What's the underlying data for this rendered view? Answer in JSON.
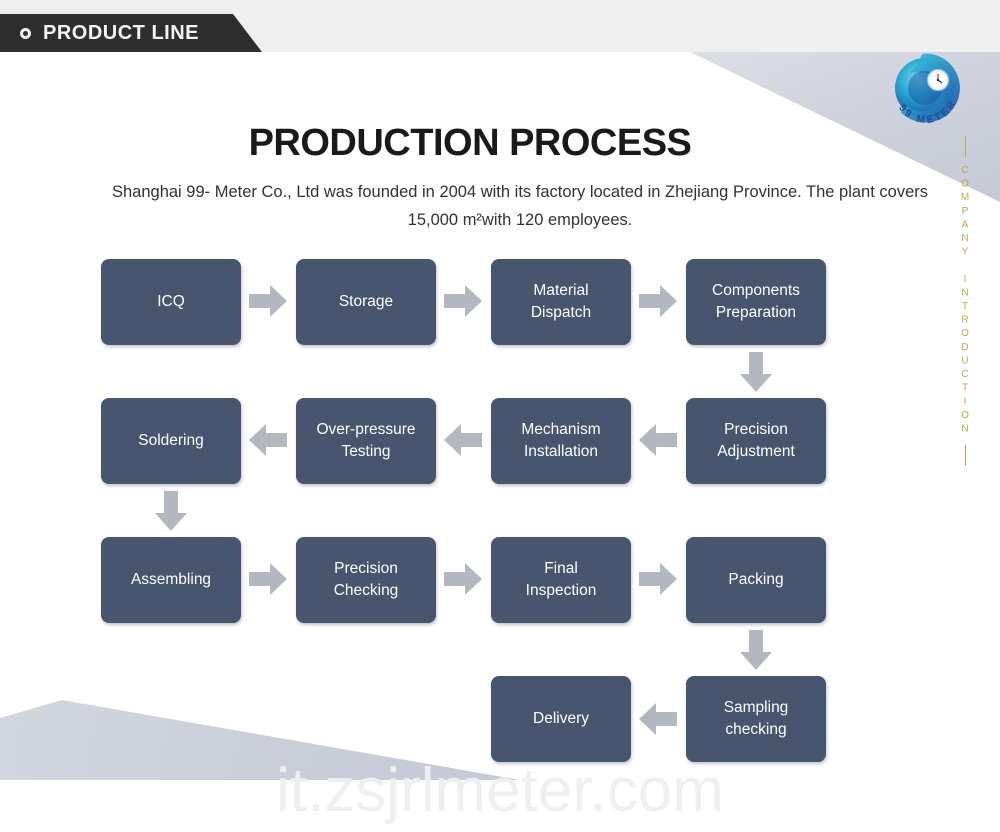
{
  "header": {
    "tab_label": "PRODUCT LINE",
    "dot_icon": "circle-outline-icon"
  },
  "logo": {
    "brand_text": "99 METER",
    "alt": "99-meter-spiral-logo"
  },
  "rail": {
    "vertical_text": "COMPANY INTRODUCTION",
    "color": "#c9a24b"
  },
  "title": "PRODUCTION PROCESS",
  "subtitle_line1": "Shanghai 99- Meter Co., Ltd was founded in 2004 with its factory located in Zhejiang",
  "subtitle_line2": "Province. The plant covers 15,000 m²with 120 employees.",
  "watermark": "it.zsjrlmeter.com",
  "colors": {
    "box_fill": "#47556e",
    "arrow_fill": "#b3b7bf",
    "header_band": "#efefef",
    "header_tab": "#2e2e2e",
    "accent_gold": "#c9a24b",
    "deco_grey": "#c9cdd8"
  },
  "flow": {
    "row1": [
      {
        "label": "ICQ"
      },
      {
        "label": "Storage"
      },
      {
        "label": "Material\nDispatch"
      },
      {
        "label": "Components\nPreparation"
      }
    ],
    "row2": [
      {
        "label": "Soldering"
      },
      {
        "label": "Over-pressure\nTesting"
      },
      {
        "label": "Mechanism\nInstallation"
      },
      {
        "label": "Precision\nAdjustment"
      }
    ],
    "row3": [
      {
        "label": "Assembling"
      },
      {
        "label": "Precision\nChecking"
      },
      {
        "label": "Final\nInspection"
      },
      {
        "label": "Packing"
      }
    ],
    "row4": [
      {
        "label": "Delivery"
      },
      {
        "label": "Sampling\nchecking"
      }
    ],
    "arrows": [
      {
        "name": "arrow-icq-to-storage",
        "dir": "right"
      },
      {
        "name": "arrow-storage-to-material-dispatch",
        "dir": "right"
      },
      {
        "name": "arrow-material-dispatch-to-components",
        "dir": "right"
      },
      {
        "name": "arrow-components-to-precision-adjustment",
        "dir": "down"
      },
      {
        "name": "arrow-precision-adjustment-to-mechanism",
        "dir": "left"
      },
      {
        "name": "arrow-mechanism-to-overpressure",
        "dir": "left"
      },
      {
        "name": "arrow-overpressure-to-soldering",
        "dir": "left"
      },
      {
        "name": "arrow-soldering-to-assembling",
        "dir": "down"
      },
      {
        "name": "arrow-assembling-to-precision-checking",
        "dir": "right"
      },
      {
        "name": "arrow-precision-checking-to-final-inspection",
        "dir": "right"
      },
      {
        "name": "arrow-final-inspection-to-packing",
        "dir": "right"
      },
      {
        "name": "arrow-packing-to-sampling",
        "dir": "down"
      },
      {
        "name": "arrow-sampling-to-delivery",
        "dir": "left"
      }
    ]
  }
}
